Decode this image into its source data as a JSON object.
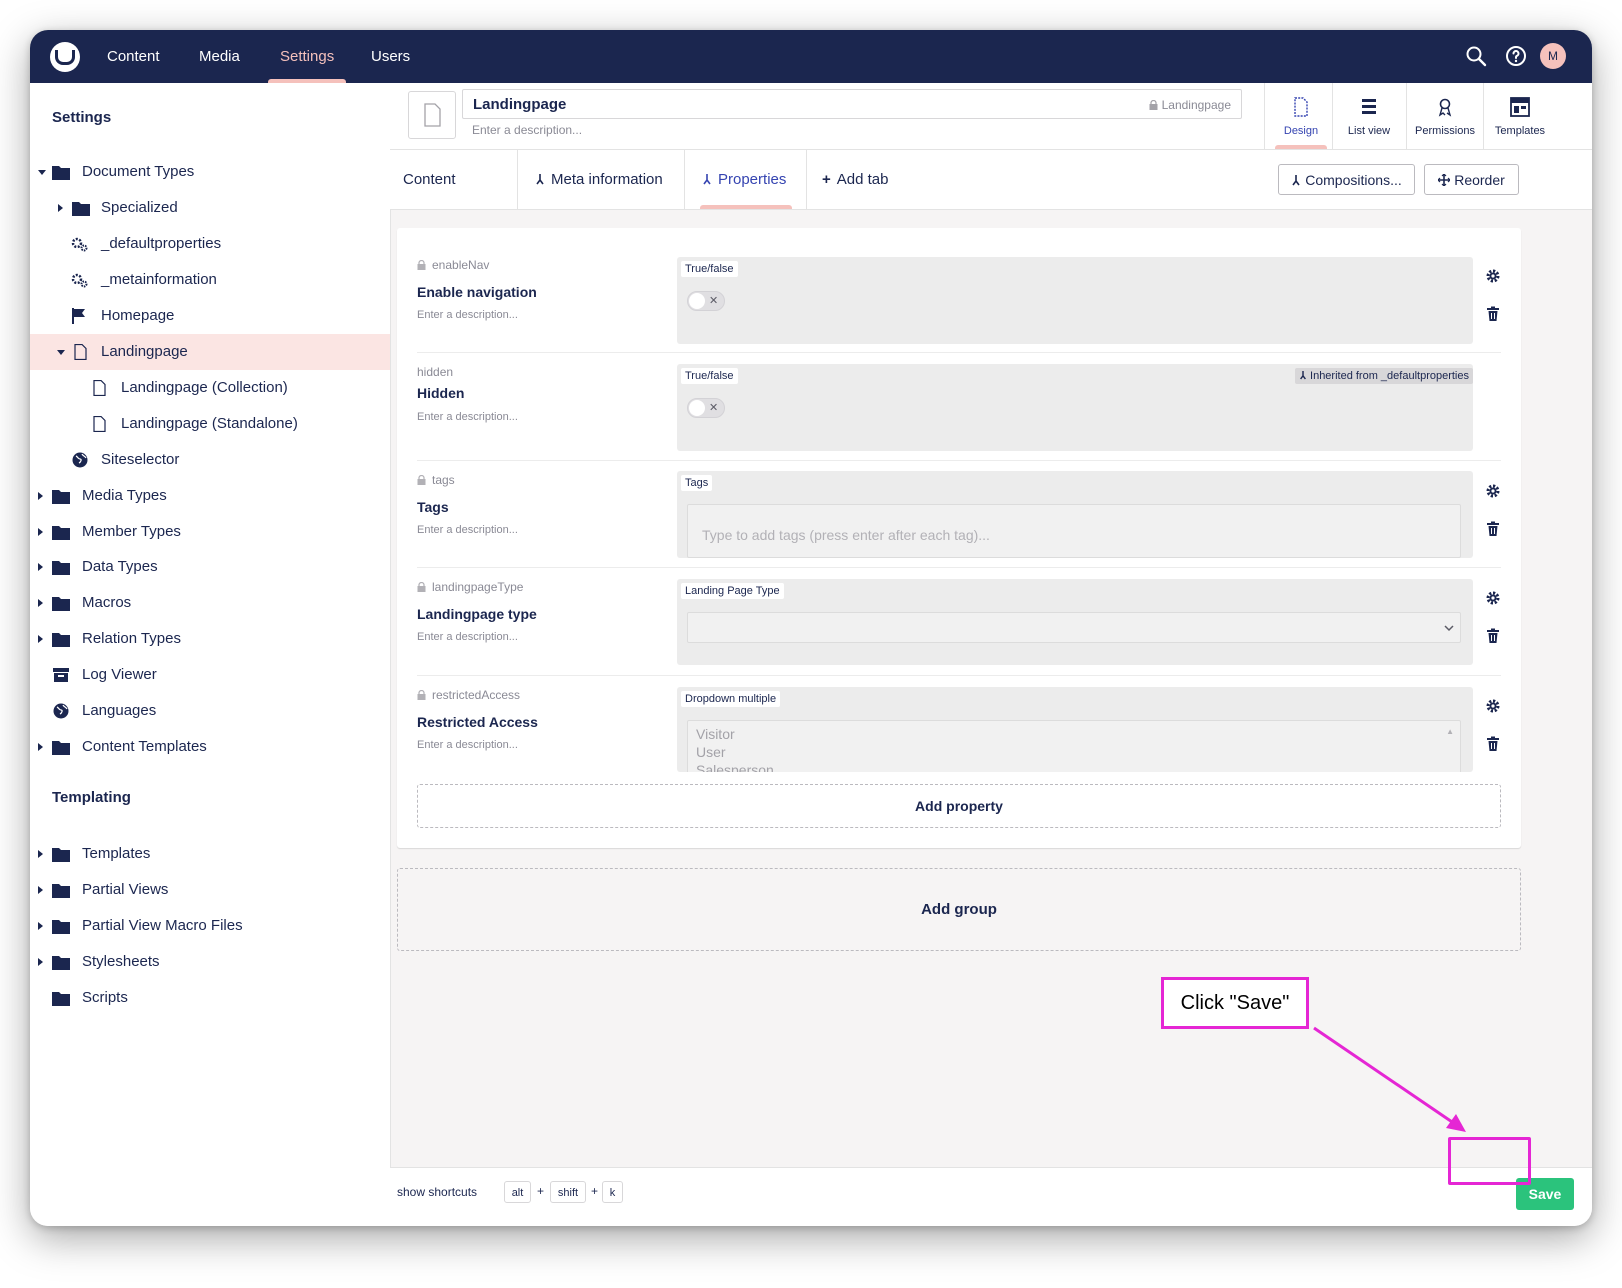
{
  "topbar": {
    "nav": [
      "Content",
      "Media",
      "Settings",
      "Users"
    ],
    "active_nav": "Settings",
    "avatar_initial": "M"
  },
  "sidebar": {
    "settings_title": "Settings",
    "templating_title": "Templating",
    "settings_items": [
      {
        "label": "Document Types",
        "icon": "folder-icon"
      },
      {
        "label": "Specialized",
        "icon": "folder-icon"
      },
      {
        "label": "_defaultproperties",
        "icon": "cogs-icon"
      },
      {
        "label": "_metainformation",
        "icon": "cogs-icon"
      },
      {
        "label": "Homepage",
        "icon": "flag-icon"
      },
      {
        "label": "Landingpage",
        "icon": "document-icon"
      },
      {
        "label": "Landingpage (Collection)",
        "icon": "document-icon"
      },
      {
        "label": "Landingpage (Standalone)",
        "icon": "document-icon"
      },
      {
        "label": "Siteselector",
        "icon": "globe-icon"
      },
      {
        "label": "Media Types",
        "icon": "folder-icon"
      },
      {
        "label": "Member Types",
        "icon": "folder-icon"
      },
      {
        "label": "Data Types",
        "icon": "folder-icon"
      },
      {
        "label": "Macros",
        "icon": "folder-icon"
      },
      {
        "label": "Relation Types",
        "icon": "folder-icon"
      },
      {
        "label": "Log Viewer",
        "icon": "box-icon"
      },
      {
        "label": "Languages",
        "icon": "globe-icon"
      },
      {
        "label": "Content Templates",
        "icon": "folder-icon"
      }
    ],
    "templating_items": [
      {
        "label": "Templates",
        "icon": "folder-icon"
      },
      {
        "label": "Partial Views",
        "icon": "folder-icon"
      },
      {
        "label": "Partial View Macro Files",
        "icon": "folder-icon"
      },
      {
        "label": "Stylesheets",
        "icon": "folder-icon"
      },
      {
        "label": "Scripts",
        "icon": "folder-icon"
      }
    ]
  },
  "header": {
    "name": "Landingpage",
    "alias": "Landingpage",
    "description_placeholder": "Enter a description...",
    "apps": [
      "Design",
      "List view",
      "Permissions",
      "Templates"
    ],
    "active_app": "Design"
  },
  "tabs": {
    "items": [
      "Content",
      "Meta information",
      "Properties",
      "Add tab"
    ],
    "active": "Properties",
    "compositions_label": "Compositions...",
    "reorder_label": "Reorder"
  },
  "properties": [
    {
      "alias": "enableNav",
      "name": "Enable navigation",
      "description": "Enter a description...",
      "editor": "True/false"
    },
    {
      "alias": "hidden",
      "name": "Hidden",
      "description": "Enter a description...",
      "editor": "True/false",
      "inherited": "Inherited from _defaultproperties"
    },
    {
      "alias": "tags",
      "name": "Tags",
      "description": "Enter a description...",
      "editor": "Tags",
      "placeholder": "Type to add tags (press enter after each tag)..."
    },
    {
      "alias": "landingpageType",
      "name": "Landingpage type",
      "description": "Enter a description...",
      "editor": "Landing Page Type"
    },
    {
      "alias": "restrictedAccess",
      "name": "Restricted Access",
      "description": "Enter a description...",
      "editor": "Dropdown multiple",
      "options": [
        "Visitor",
        "User",
        "Salesperson"
      ]
    }
  ],
  "add_property_label": "Add property",
  "add_group_label": "Add group",
  "footer": {
    "shortcuts_label": "show shortcuts",
    "keys": [
      "alt",
      "shift",
      "k"
    ],
    "save_label": "Save"
  },
  "annotation": {
    "callout_text": "Click \"Save\"",
    "accent_color": "#e526d4"
  },
  "colors": {
    "brand_navy": "#1b264f",
    "accent_pink": "#f5c1bc",
    "save_green": "#2bc37c"
  }
}
